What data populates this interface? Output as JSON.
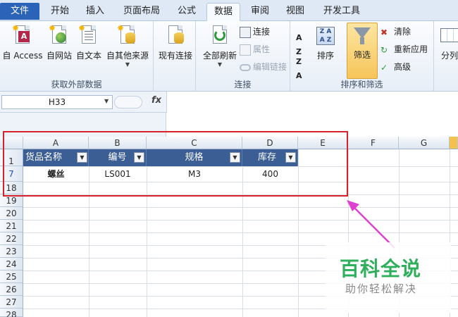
{
  "tabs": [
    "文件",
    "开始",
    "插入",
    "页面布局",
    "公式",
    "数据",
    "审阅",
    "视图",
    "开发工具"
  ],
  "active_tab": "数据",
  "ribbon": {
    "external": {
      "label": "获取外部数据",
      "buttons": [
        "自 Access",
        "自网站",
        "自文本",
        "自其他来源"
      ]
    },
    "existing": {
      "label": "现有连接"
    },
    "connections": {
      "label": "连接",
      "refresh_all": "全部刷新",
      "connect": "连接",
      "properties": "属性",
      "edit_links": "编辑链接"
    },
    "sortfilter": {
      "label": "排序和筛选",
      "sort": "排序",
      "filter": "筛选",
      "clear": "清除",
      "reapply": "重新应用",
      "advanced": "高级"
    },
    "split": "分列"
  },
  "formula_bar": {
    "name_box": "H33",
    "fx": "fx",
    "value": ""
  },
  "columns": [
    "A",
    "B",
    "C",
    "D",
    "E",
    "F",
    "G"
  ],
  "rows": [
    "1",
    "7",
    "18",
    "19",
    "20",
    "21",
    "22",
    "23",
    "24",
    "25",
    "26",
    "27",
    "28"
  ],
  "table": {
    "headers": [
      "货品名称",
      "编号",
      "规格",
      "库存"
    ],
    "row": [
      "螺丝",
      "LS001",
      "M3",
      "400"
    ]
  },
  "watermark": {
    "title": "百科全说",
    "subtitle": "助你轻松解决"
  },
  "colors": {
    "header_blue": "#3b5f95",
    "highlight_red": "#d8222b",
    "arrow_magenta": "#e040d0",
    "brand_green": "#2fae5c"
  }
}
